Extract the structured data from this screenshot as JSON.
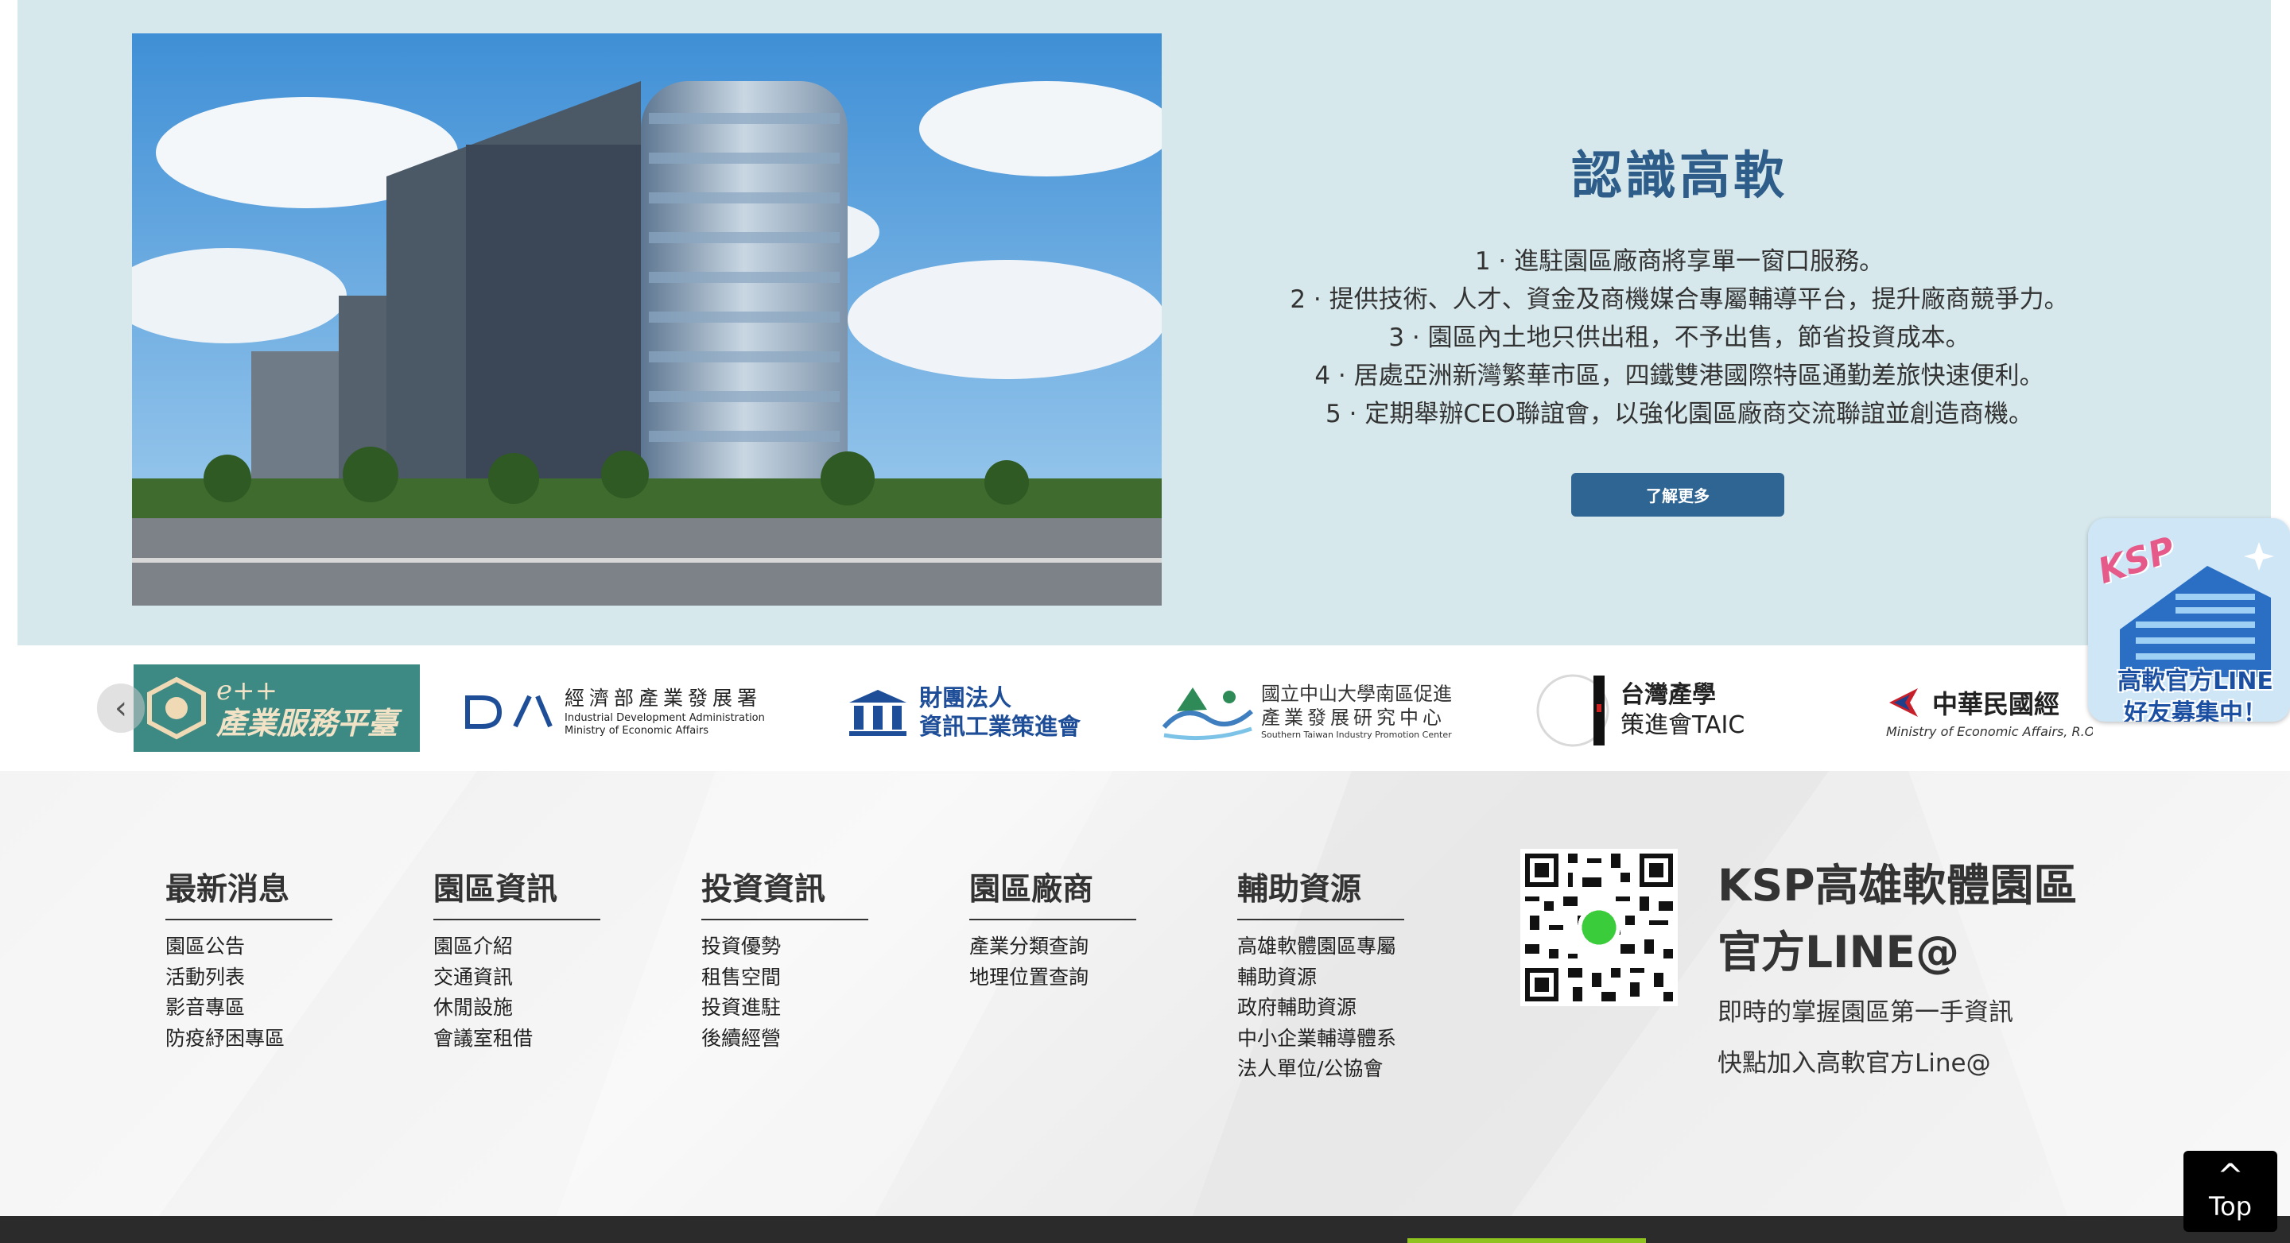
{
  "intro": {
    "title": "認識高軟",
    "points": [
      "1 · 進駐園區廠商將享單一窗口服務。",
      "2 · 提供技術、人才、資金及商機媒合專屬輔導平台，提升廠商競爭力。",
      "3 · 園區內土地只供出租，不予出售，節省投資成本。",
      "4 · 居處亞洲新灣繁華市區，四鐵雙港國際特區通勤差旅快速便利。",
      "5 · 定期舉辦CEO聯誼會，以強化園區廠商交流聯誼並創造商機。"
    ],
    "more_button": "了解更多"
  },
  "partners": {
    "prev_arrow": "‹",
    "items": [
      {
        "name": "eplus",
        "line1": "e++",
        "line2": "產業服務平臺"
      },
      {
        "name": "ida",
        "zh": "經濟部產業發展署",
        "en1": "Industrial Development Administration",
        "en2": "Ministry of Economic Affairs"
      },
      {
        "name": "iii",
        "line1": "財團法人",
        "line2": "資訊工業策進會"
      },
      {
        "name": "nsysu",
        "line1": "國立中山大學南區促進",
        "line2": "產業發展研究中心",
        "en": "Southern Taiwan Industry Promotion Center"
      },
      {
        "name": "taic",
        "line1": "台灣產學",
        "line2": "策進會TAIC"
      },
      {
        "name": "moea",
        "zh": "中華民國經",
        "en": "Ministry of Economic Affairs, R.O.C."
      }
    ]
  },
  "footer": {
    "columns": [
      {
        "title": "最新消息",
        "links": [
          "園區公告",
          "活動列表",
          "影音專區",
          "防疫紓困專區"
        ]
      },
      {
        "title": "園區資訊",
        "links": [
          "園區介紹",
          "交通資訊",
          "休閒設施",
          "會議室租借"
        ]
      },
      {
        "title": "投資資訊",
        "links": [
          "投資優勢",
          "租售空間",
          "投資進駐",
          "後續經營"
        ]
      },
      {
        "title": "園區廠商",
        "links": [
          "產業分類查詢",
          "地理位置查詢"
        ]
      },
      {
        "title": "輔助資源",
        "links": [
          "高雄軟體園區專屬",
          "輔助資源",
          "政府輔助資源",
          "中小企業輔導體系",
          "法人單位/公協會"
        ]
      }
    ],
    "line": {
      "title1": "KSP高雄軟體園區",
      "title2": "官方LINE@",
      "sub1": "即時的掌握園區第一手資訊",
      "sub2": "快點加入高軟官方Line@"
    }
  },
  "float": {
    "ksp": "KSP",
    "line1": "高軟官方LINE",
    "line2": "好友募集中！"
  },
  "top_button": {
    "icon": "^",
    "label": "Top"
  }
}
